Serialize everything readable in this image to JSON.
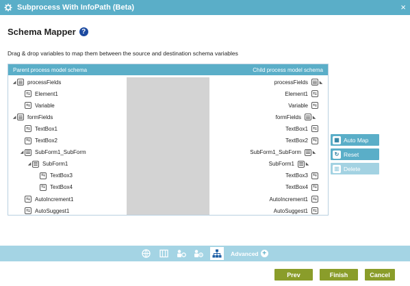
{
  "window": {
    "title": "Subprocess With InfoPath (Beta)",
    "close_glyph": "×"
  },
  "heading": "Schema Mapper",
  "help_glyph": "?",
  "description": "Drag & drop variables to map them between the source and destination schema variables",
  "mapper": {
    "left_header": "Parent process model schema",
    "right_header": "Child process model schema",
    "left_rows": [
      {
        "label": "processFields",
        "kind": "node",
        "expander": "◢"
      },
      {
        "label": "Element1",
        "kind": "var"
      },
      {
        "label": "Variable",
        "kind": "var"
      },
      {
        "label": "formFields",
        "kind": "node",
        "expander": "◢"
      },
      {
        "label": "TextBox1",
        "kind": "var"
      },
      {
        "label": "TextBox2",
        "kind": "var"
      },
      {
        "label": "SubForm1_SubForm",
        "kind": "node",
        "expander": "◢"
      },
      {
        "label": "SubForm1",
        "kind": "node",
        "expander": "◢"
      },
      {
        "label": "TextBox3",
        "kind": "var"
      },
      {
        "label": "TextBox4",
        "kind": "var"
      },
      {
        "label": "AutoIncrement1",
        "kind": "var"
      },
      {
        "label": "AutoSuggest1",
        "kind": "var"
      }
    ],
    "right_rows": [
      {
        "label": "processFields",
        "kind": "node",
        "expander": "◣"
      },
      {
        "label": "Element1",
        "kind": "var"
      },
      {
        "label": "Variable",
        "kind": "var"
      },
      {
        "label": "formFields",
        "kind": "node",
        "expander": "◣"
      },
      {
        "label": "TextBox1",
        "kind": "var"
      },
      {
        "label": "TextBox2",
        "kind": "var"
      },
      {
        "label": "SubForm1_SubForm",
        "kind": "node",
        "expander": "◣"
      },
      {
        "label": "SubForm1",
        "kind": "node",
        "expander": "◣"
      },
      {
        "label": "TextBox3",
        "kind": "var"
      },
      {
        "label": "TextBox4",
        "kind": "var"
      },
      {
        "label": "AutoIncrement1",
        "kind": "var"
      },
      {
        "label": "AutoSuggest1",
        "kind": "var"
      }
    ]
  },
  "side_buttons": {
    "auto_map": "Auto Map",
    "reset": "Reset",
    "delete": "Delete"
  },
  "toolbar": {
    "icons": [
      "globe-icon",
      "map-icon",
      "user-settings-icon",
      "user-options-icon",
      "hierarchy-icon"
    ],
    "advanced_label": "Advanced",
    "advanced_glyph": "+"
  },
  "footer": {
    "prev": "Prev",
    "finish": "Finish",
    "cancel": "Cancel"
  },
  "colors": {
    "accent": "#5aaec8",
    "toolbar": "#a4d4e4",
    "footer_button": "#8a9d2a",
    "help": "#1c4aa0"
  }
}
